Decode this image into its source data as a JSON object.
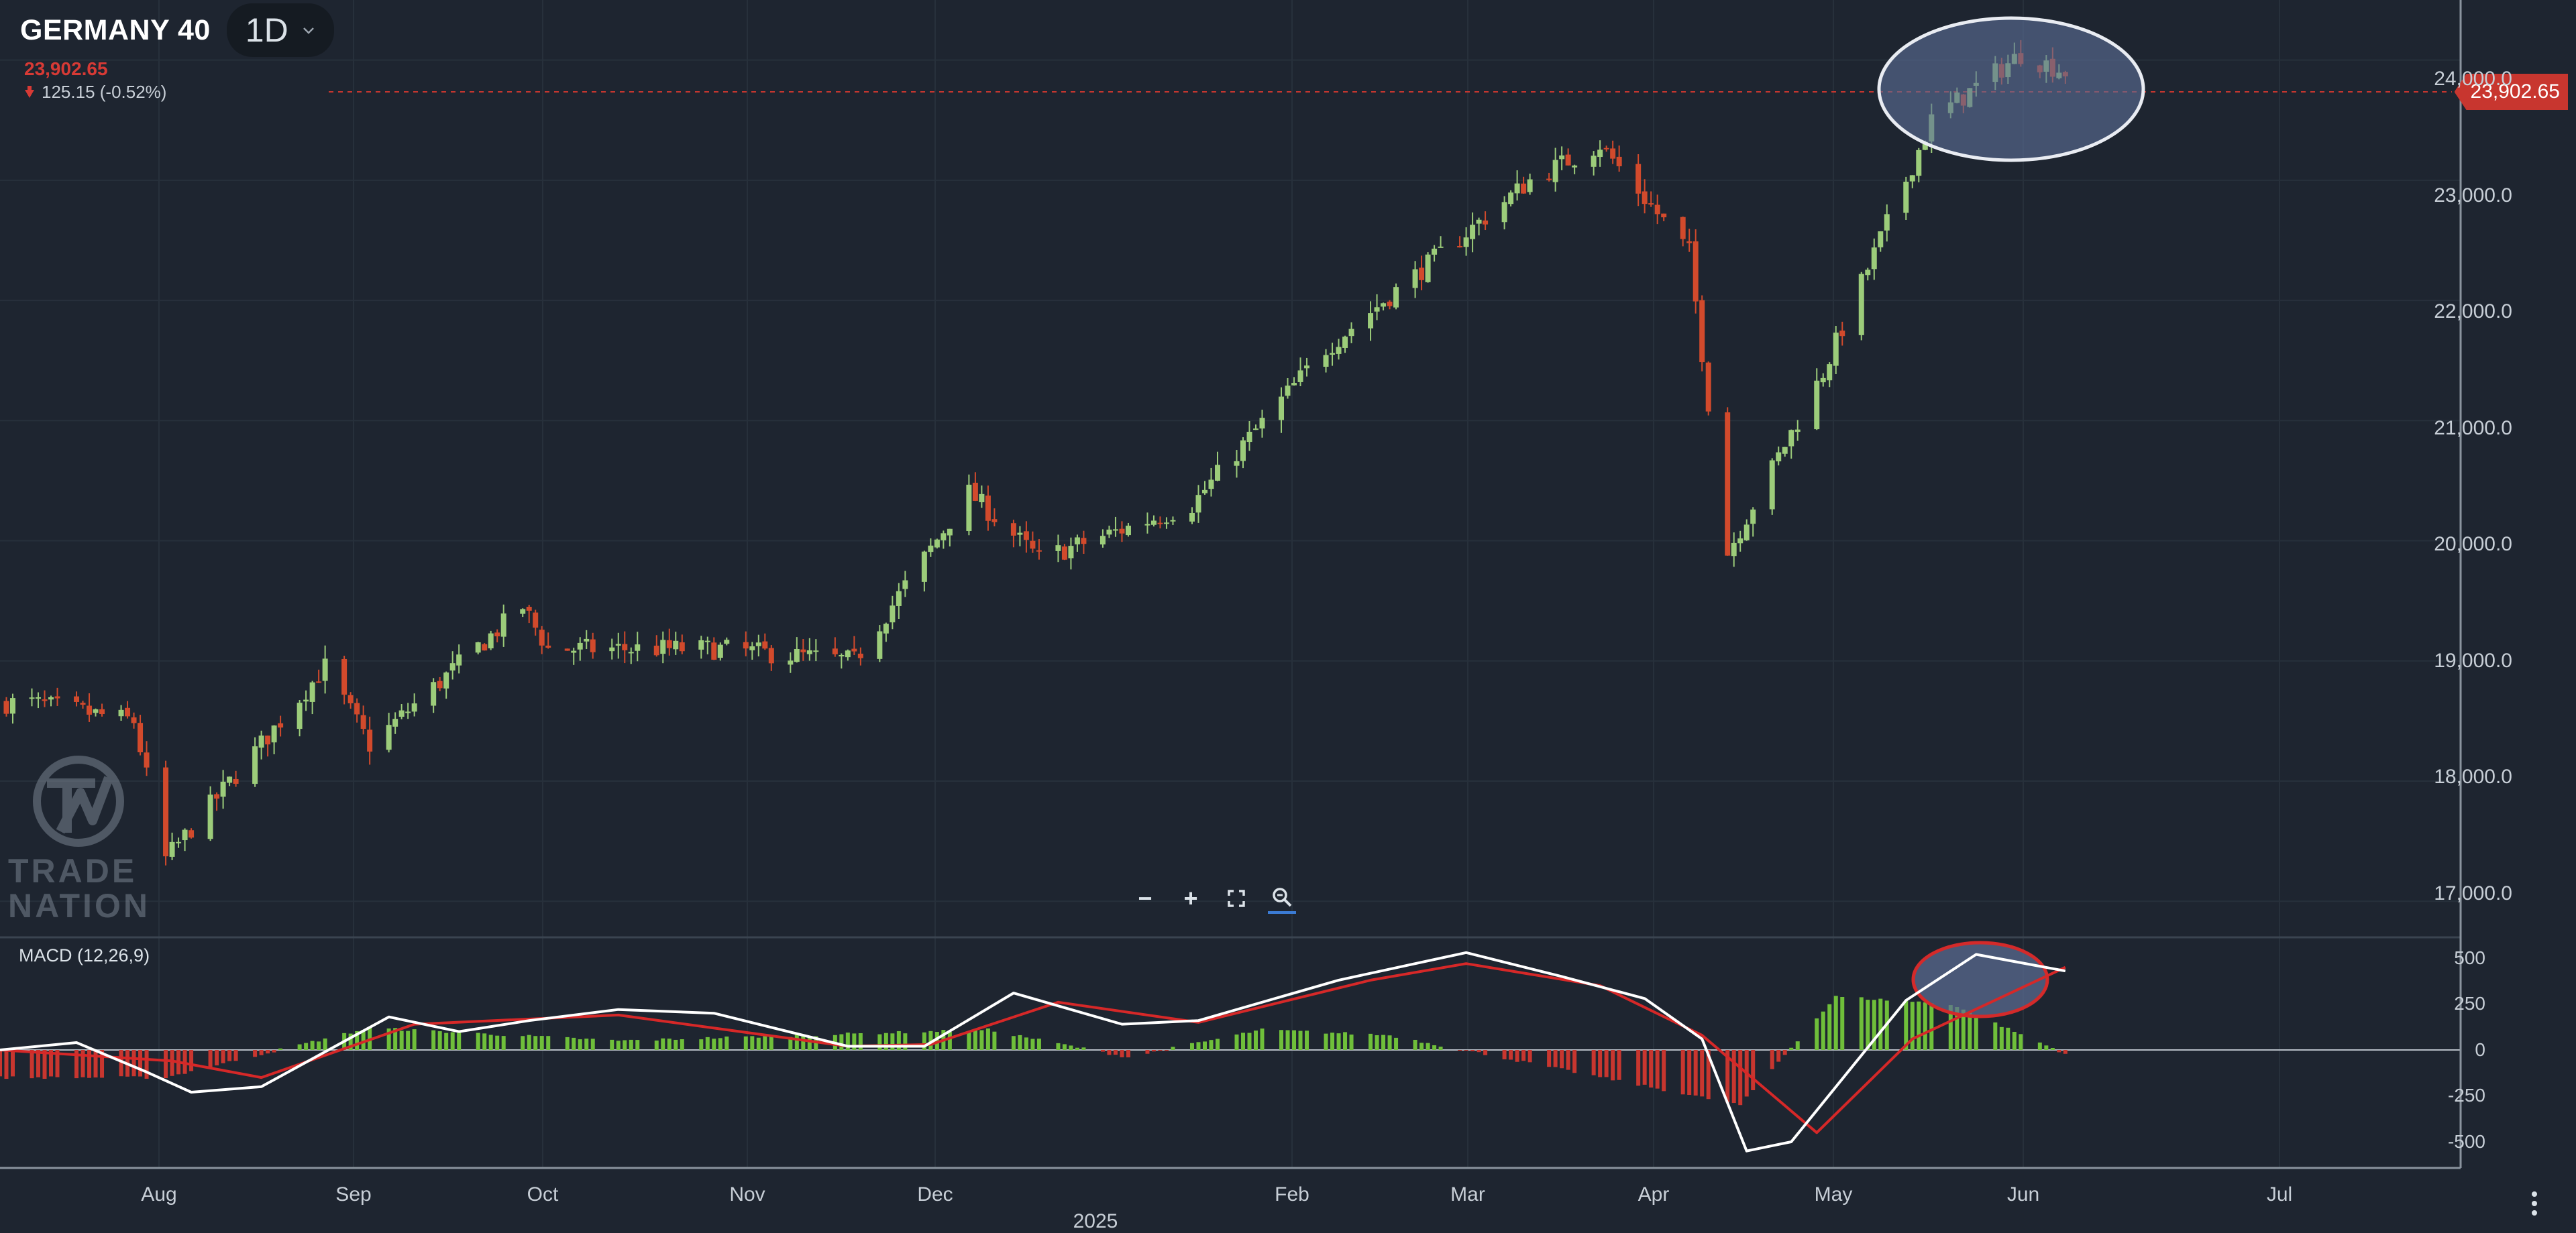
{
  "symbol": {
    "name": "GERMANY 40",
    "timeframe": "1D",
    "price": "23,902.65",
    "change": "125.15 (-0.52%)"
  },
  "price_tag": "23,902.65",
  "y_axis": {
    "labels": [
      "24,000.0",
      "23,000.0",
      "22,000.0",
      "21,000.0",
      "20,000.0",
      "19,000.0",
      "18,000.0",
      "17,000.0"
    ]
  },
  "macd": {
    "title": "MACD (12,26,9)",
    "axis_labels": [
      "500",
      "250",
      "0",
      "-250",
      "-500"
    ]
  },
  "x_axis": {
    "months": [
      "Aug",
      "Sep",
      "Oct",
      "Nov",
      "Dec",
      "Feb",
      "Mar",
      "Apr",
      "May",
      "Jun",
      "Jul"
    ],
    "year_marker": "2025"
  },
  "logo": {
    "line1": "TRADE",
    "line2": "NATION"
  },
  "zoom_controls": {
    "zoom_out": "−",
    "zoom_in": "+",
    "fullscreen": "⛶",
    "reset_zoom": "🔍"
  },
  "colors": {
    "background": "#1e2530",
    "up": "#9ccc7a",
    "down": "#d24a2c",
    "macd_line": "#ffffff",
    "signal_line": "#d62828",
    "highlight_fill": "#5a6a90",
    "price_tag": "#c8362f"
  },
  "chart_data": [
    {
      "type": "candlestick",
      "title": "GERMANY 40",
      "ylim": [
        16700,
        24500
      ],
      "x_range": [
        "2024-07-10",
        "2025-07-31"
      ],
      "grid": true,
      "last_price": 23902.65,
      "series": [
        {
          "x": "2024-07-15",
          "value": 18650
        },
        {
          "x": "2024-07-31",
          "value": 18500
        },
        {
          "x": "2024-08-05",
          "value": 17350
        },
        {
          "x": "2024-08-30",
          "value": 18950
        },
        {
          "x": "2024-09-06",
          "value": 18300
        },
        {
          "x": "2024-09-30",
          "value": 19450
        },
        {
          "x": "2024-10-04",
          "value": 19100
        },
        {
          "x": "2024-10-31",
          "value": 19100
        },
        {
          "x": "2024-11-21",
          "value": 19000
        },
        {
          "x": "2024-12-09",
          "value": 20400
        },
        {
          "x": "2024-12-20",
          "value": 19850
        },
        {
          "x": "2025-01-13",
          "value": 20300
        },
        {
          "x": "2025-02-03",
          "value": 21600
        },
        {
          "x": "2025-02-19",
          "value": 22300
        },
        {
          "x": "2025-03-07",
          "value": 23000
        },
        {
          "x": "2025-03-18",
          "value": 23300
        },
        {
          "x": "2025-04-01",
          "value": 22400
        },
        {
          "x": "2025-04-07",
          "value": 19900
        },
        {
          "x": "2025-04-22",
          "value": 21400
        },
        {
          "x": "2025-05-09",
          "value": 23500
        },
        {
          "x": "2025-05-23",
          "value": 24050
        },
        {
          "x": "2025-05-30",
          "value": 23902.65
        }
      ]
    },
    {
      "type": "line",
      "title": "MACD (12,26,9)",
      "ylim": [
        -650,
        600
      ],
      "series": [
        {
          "name": "MACD",
          "points": [
            {
              "x": "2024-07-10",
              "y": 0
            },
            {
              "x": "2024-07-22",
              "y": 40
            },
            {
              "x": "2024-08-02",
              "y": -120
            },
            {
              "x": "2024-08-09",
              "y": -230
            },
            {
              "x": "2024-08-20",
              "y": -200
            },
            {
              "x": "2024-09-09",
              "y": 180
            },
            {
              "x": "2024-09-20",
              "y": 100
            },
            {
              "x": "2024-10-01",
              "y": 160
            },
            {
              "x": "2024-10-15",
              "y": 220
            },
            {
              "x": "2024-10-30",
              "y": 200
            },
            {
              "x": "2024-11-20",
              "y": 20
            },
            {
              "x": "2024-12-02",
              "y": 20
            },
            {
              "x": "2024-12-16",
              "y": 310
            },
            {
              "x": "2025-01-02",
              "y": 140
            },
            {
              "x": "2025-01-14",
              "y": 160
            },
            {
              "x": "2025-02-05",
              "y": 380
            },
            {
              "x": "2025-02-25",
              "y": 530
            },
            {
              "x": "2025-03-12",
              "y": 400
            },
            {
              "x": "2025-03-25",
              "y": 280
            },
            {
              "x": "2025-04-03",
              "y": 60
            },
            {
              "x": "2025-04-10",
              "y": -550
            },
            {
              "x": "2025-04-17",
              "y": -500
            },
            {
              "x": "2025-05-05",
              "y": 270
            },
            {
              "x": "2025-05-16",
              "y": 520
            },
            {
              "x": "2025-05-30",
              "y": 430
            }
          ]
        },
        {
          "name": "Signal",
          "points": [
            {
              "x": "2024-07-10",
              "y": 0
            },
            {
              "x": "2024-08-06",
              "y": -60
            },
            {
              "x": "2024-08-20",
              "y": -150
            },
            {
              "x": "2024-09-13",
              "y": 140
            },
            {
              "x": "2024-10-15",
              "y": 190
            },
            {
              "x": "2024-11-20",
              "y": 20
            },
            {
              "x": "2024-12-03",
              "y": 30
            },
            {
              "x": "2024-12-23",
              "y": 260
            },
            {
              "x": "2025-01-14",
              "y": 150
            },
            {
              "x": "2025-02-10",
              "y": 380
            },
            {
              "x": "2025-02-25",
              "y": 470
            },
            {
              "x": "2025-03-18",
              "y": 350
            },
            {
              "x": "2025-04-03",
              "y": 80
            },
            {
              "x": "2025-04-21",
              "y": -450
            },
            {
              "x": "2025-05-06",
              "y": 60
            },
            {
              "x": "2025-05-30",
              "y": 450
            }
          ]
        },
        {
          "name": "Histogram",
          "points": [
            {
              "x": "2024-08-05",
              "y": -150
            },
            {
              "x": "2024-09-06",
              "y": 120
            },
            {
              "x": "2024-10-15",
              "y": 50
            },
            {
              "x": "2024-12-12",
              "y": 110
            },
            {
              "x": "2025-01-03",
              "y": -40
            },
            {
              "x": "2025-01-24",
              "y": 110
            },
            {
              "x": "2025-02-13",
              "y": 80
            },
            {
              "x": "2025-04-09",
              "y": -300
            },
            {
              "x": "2025-04-24",
              "y": 290
            },
            {
              "x": "2025-05-12",
              "y": 250
            },
            {
              "x": "2025-05-30",
              "y": -20
            }
          ]
        }
      ]
    }
  ]
}
